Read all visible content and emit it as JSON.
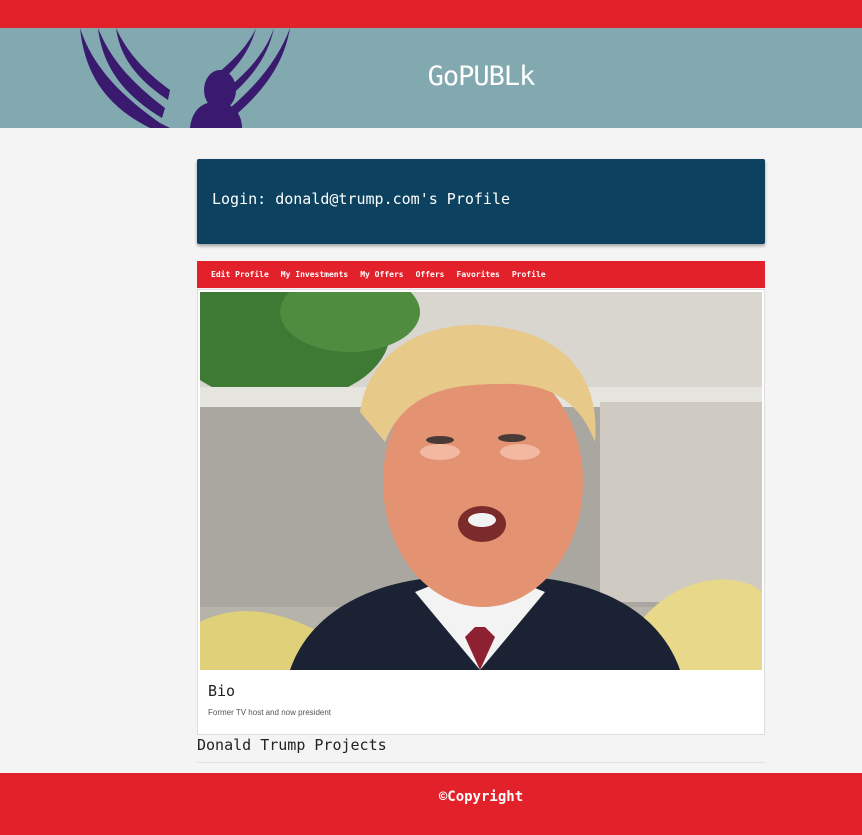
{
  "header": {
    "site_title": "GoPUBLk",
    "logo_icon": "winged-figure-logo"
  },
  "login_card": {
    "text": "Login: donald@trump.com's Profile"
  },
  "nav": {
    "items": [
      {
        "label": "Edit Profile"
      },
      {
        "label": "My Investments"
      },
      {
        "label": "My Offers"
      },
      {
        "label": "Offers"
      },
      {
        "label": "Favorites"
      },
      {
        "label": "Profile"
      }
    ]
  },
  "profile": {
    "bio_heading": "Bio",
    "bio_text": "Former TV host and now president"
  },
  "projects": {
    "heading": "Donald Trump Projects"
  },
  "footer": {
    "copyright": "©Copyright"
  },
  "colors": {
    "accent_red": "#e3212a",
    "header_teal": "#82a8b0",
    "login_navy": "#0c425f",
    "logo_purple": "#3a1a6e"
  }
}
